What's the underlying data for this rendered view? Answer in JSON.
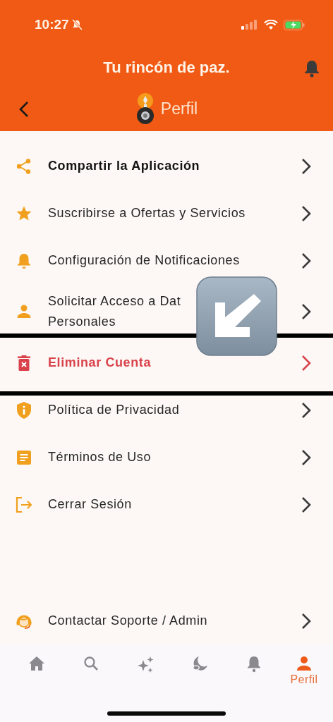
{
  "status_bar": {
    "time": "10:27"
  },
  "header": {
    "title": "Tu rincón de paz.",
    "subtitle": "Perfil"
  },
  "menu": [
    {
      "label": [
        "Compartir la Aplicación"
      ],
      "kind": "bold"
    },
    {
      "label": [
        "Suscribirse a Ofertas y Servicios"
      ],
      "kind": "normal"
    },
    {
      "label": [
        "Configuración de Notificaciones"
      ],
      "kind": "normal"
    },
    {
      "label": [
        "Solicitar Acceso a Dat",
        "Personales"
      ],
      "kind": "normal"
    },
    {
      "label": [
        "Eliminar Cuenta"
      ],
      "kind": "danger"
    },
    {
      "label": [
        "Política de Privacidad"
      ],
      "kind": "normal"
    },
    {
      "label": [
        "Términos de Uso"
      ],
      "kind": "normal"
    },
    {
      "label": [
        "Cerrar Sesión"
      ],
      "kind": "normal"
    },
    {
      "label": [
        "Contactar Soporte / Admin"
      ],
      "kind": "normal"
    }
  ],
  "bottom_nav": [
    {
      "selected": false
    },
    {
      "selected": false
    },
    {
      "selected": false
    },
    {
      "selected": false
    },
    {
      "selected": false
    },
    {
      "label": "Perfil",
      "selected": true
    }
  ]
}
